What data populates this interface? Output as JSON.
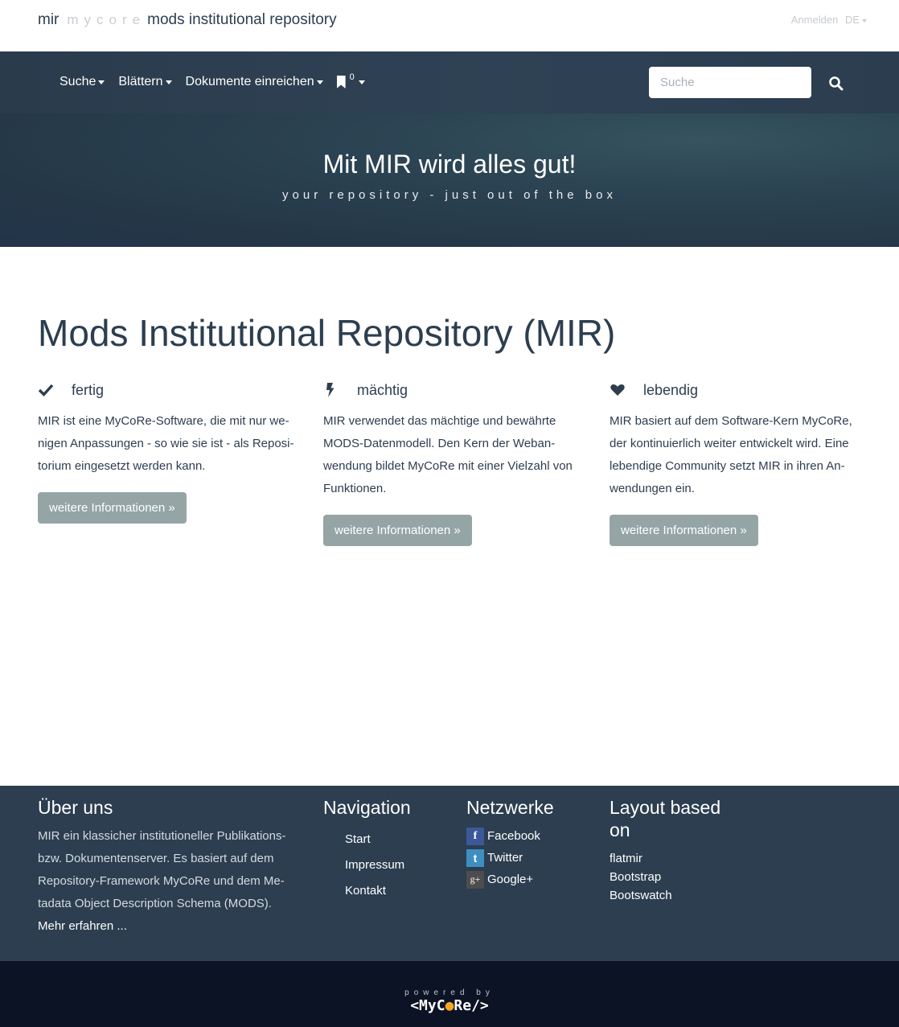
{
  "header": {
    "brand_short": "mir",
    "brand_mycore": "mycore",
    "brand_title": "mods institutional repository",
    "login_label": "Anmelden",
    "language": "DE"
  },
  "nav": {
    "items": [
      {
        "label": "Suche"
      },
      {
        "label": "Blättern"
      },
      {
        "label": "Dokumente einreichen"
      }
    ],
    "basket_count": "0",
    "search_placeholder": "Suche"
  },
  "hero": {
    "title": "Mit MIR wird alles gut!",
    "subtitle": "your repository - just out of the box"
  },
  "main": {
    "heading": "Mods Institutional Repository (MIR)",
    "features": [
      {
        "icon": "check-icon",
        "title": "fertig",
        "text": "MIR ist eine MyCoRe-Software, die mit nur we­nigen Anpassungen - so wie sie ist - als Reposi­torium eingesetzt werden kann.",
        "button": "weitere Informationen »"
      },
      {
        "icon": "bolt-icon",
        "title": "mächtig",
        "text": "MIR verwendet das mächtige und bewährte MODS-Datenmodell. Den Kern der Weban­wendung bildet MyCoRe mit einer Vielzahl von Funktionen.",
        "button": "weitere Informationen »"
      },
      {
        "icon": "heart-icon",
        "title": "lebendig",
        "text": "MIR basiert auf dem Software-Kern MyCoRe, der kontinuierlich weiter entwickelt wird. Eine lebendige Community setzt MIR in ihren An­wendungen ein.",
        "button": "weitere Informationen »"
      }
    ]
  },
  "footer": {
    "about": {
      "title": "Über uns",
      "text": "MIR ein klassicher institutioneller Publikations- bzw. Dokumentenserver. Es basiert auf dem Repository-Framework MyCoRe und dem Me­tadata Object Description Schema (MODS).",
      "more": "Mehr erfahren ..."
    },
    "navigation": {
      "title": "Navigation",
      "items": [
        "Start",
        "Impressum",
        "Kontakt"
      ]
    },
    "networks": {
      "title": "Netzwerke",
      "items": [
        {
          "label": "Facebook",
          "icon": "facebook-icon",
          "glyph": "f"
        },
        {
          "label": "Twitter",
          "icon": "twitter-icon",
          "glyph": "t"
        },
        {
          "label": "Google+",
          "icon": "google-plus-icon",
          "glyph": "g+"
        }
      ]
    },
    "layout": {
      "title": "Layout based on",
      "items": [
        "flatmir",
        "Bootstrap",
        "Bootswatch"
      ]
    }
  },
  "bottom": {
    "powered_by": "powered by",
    "logo_left": "<MyC",
    "logo_dot": "●",
    "logo_right": "Re/>"
  },
  "colors": {
    "navbar": "#2c3e50",
    "button": "#95a5a6",
    "footer": "#2c3e50",
    "bottombar": "#0c1324"
  }
}
